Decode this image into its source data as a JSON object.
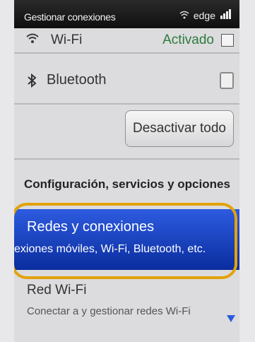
{
  "statusbar": {
    "title": "Gestionar conexiones",
    "network": "edge",
    "icons": [
      "wifi-status-icon",
      "signal-icon"
    ]
  },
  "wifi": {
    "label": "Wi-Fi",
    "value": "Activado",
    "icon": "wifi-icon"
  },
  "bluetooth": {
    "label": "Bluetooth",
    "icon": "bluetooth-icon",
    "checked": false
  },
  "actions": {
    "deactivate_all": "Desactivar todo"
  },
  "section": {
    "title": "Configuración, servicios y opciones"
  },
  "menu": {
    "selected": {
      "title": "Redes y conexiones",
      "description": "exiones móviles, Wi-Fi, Bluetooth, etc."
    },
    "next": {
      "title": "Red Wi-Fi",
      "description": "Conectar a y gestionar redes Wi-Fi"
    }
  },
  "colors": {
    "highlight": "#0a2d9e",
    "outline": "#e2a20a",
    "status_green": "#2d7a3e"
  }
}
